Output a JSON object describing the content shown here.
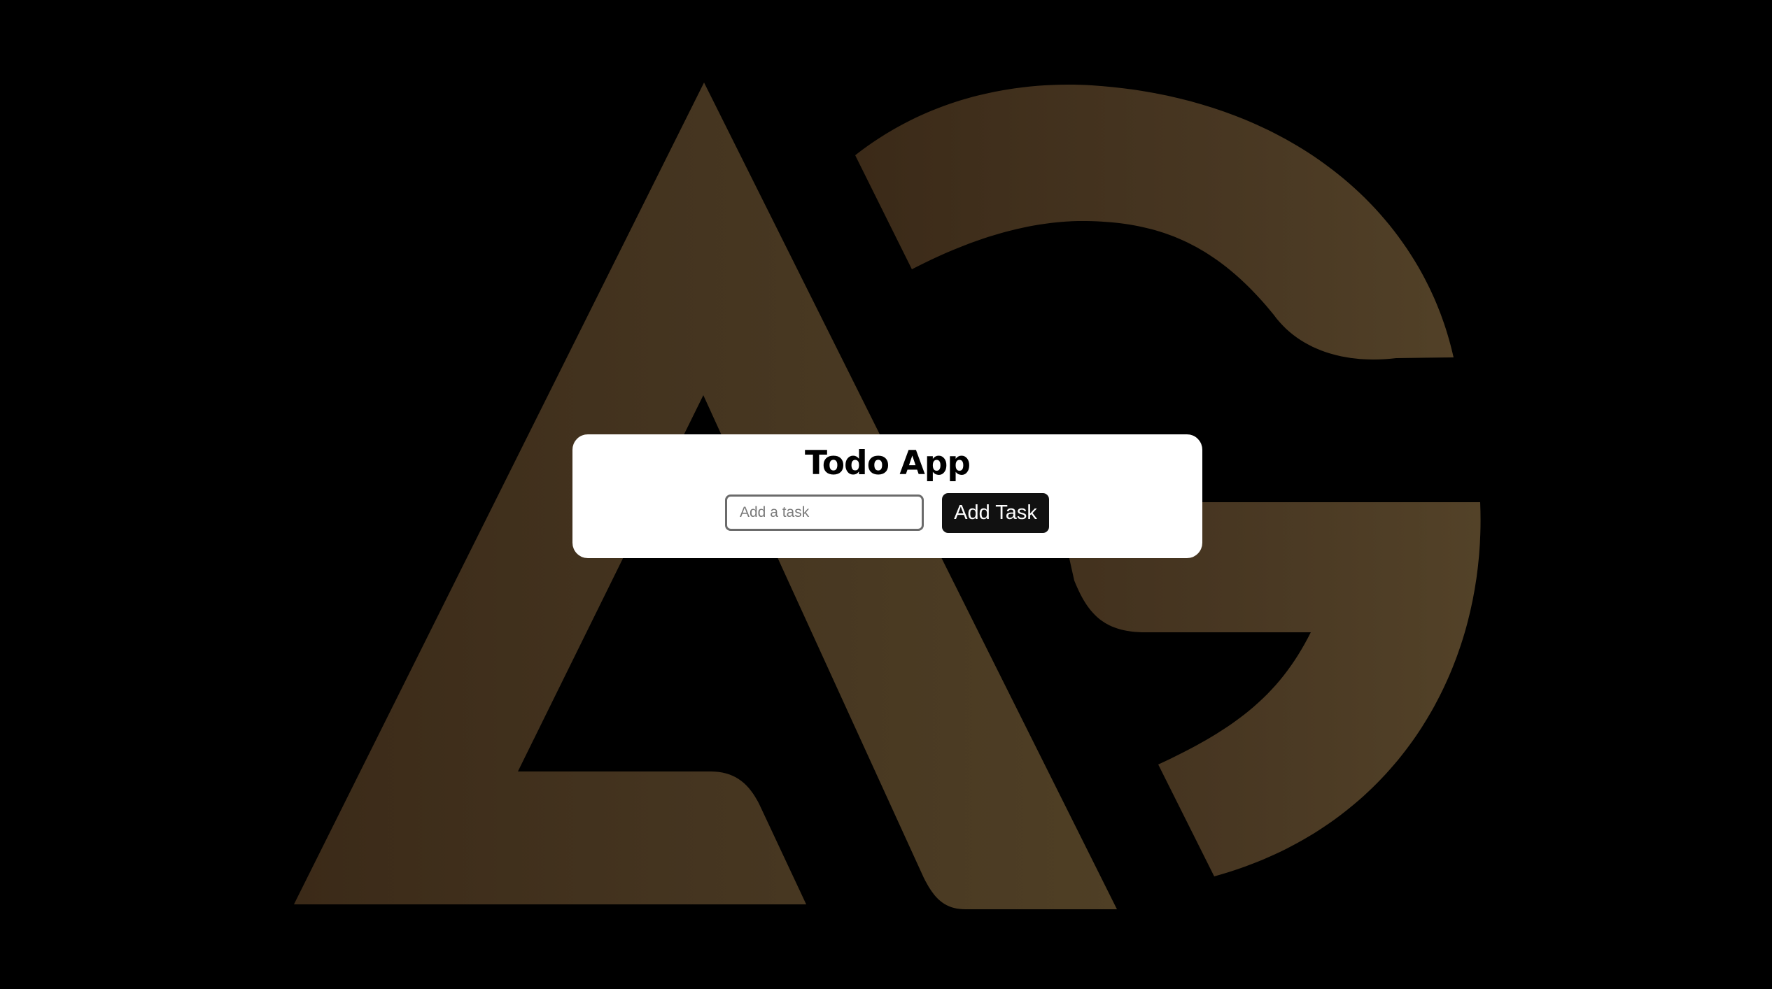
{
  "app": {
    "title": "Todo App"
  },
  "form": {
    "input_value": "",
    "input_placeholder": "Add a task",
    "add_button_label": "Add Task"
  },
  "tasks": [],
  "background": {
    "logo_letters": "AG",
    "logo_color": "#4a3a22",
    "page_color": "#000000"
  }
}
